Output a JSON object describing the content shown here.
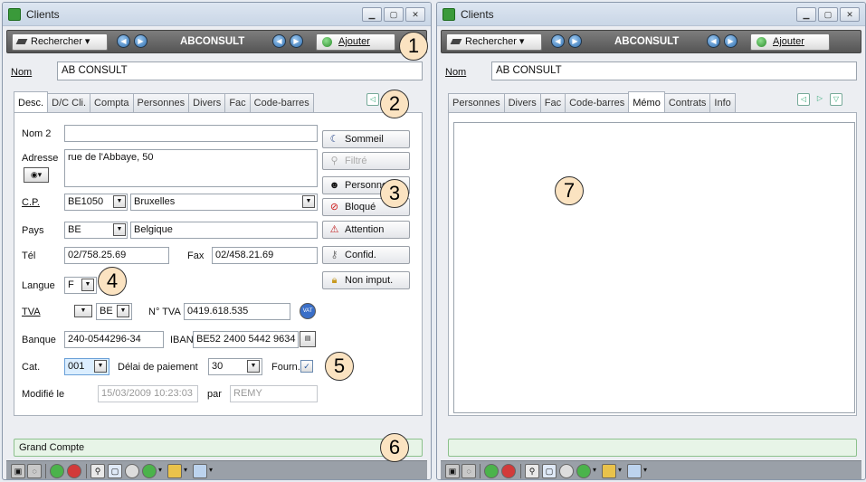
{
  "left": {
    "title": "Clients",
    "toolbar": {
      "search": "Rechercher",
      "company": "ABCONSULT",
      "add": "Ajouter"
    },
    "nom_label": "Nom",
    "nom_value": "AB CONSULT",
    "tabs": [
      "Desc.",
      "D/C Cli.",
      "Compta",
      "Personnes",
      "Divers",
      "Fac",
      "Code-barres"
    ],
    "form": {
      "nom2_label": "Nom 2",
      "nom2_value": "",
      "adresse_label": "Adresse",
      "adresse_value": "rue de l'Abbaye, 50",
      "cp_label": "C.P.",
      "cp_value": "BE1050",
      "city_value": "Bruxelles",
      "pays_label": "Pays",
      "pays_code": "BE",
      "pays_name": "Belgique",
      "tel_label": "Tél",
      "tel_value": "02/758.25.69",
      "fax_label": "Fax",
      "fax_value": "02/458.21.69",
      "langue_label": "Langue",
      "langue_value": "F",
      "tva_label": "TVA",
      "tva_country": "BE",
      "ntva_label": "N° TVA",
      "ntva_value": "0419.618.535",
      "banque_label": "Banque",
      "banque_value": "240-0544296-34",
      "iban_label": "IBAN",
      "iban_value": "BE52 2400 5442 9634",
      "cat_label": "Cat.",
      "cat_value": "001",
      "delai_label": "Délai de paiement",
      "delai_value": "30",
      "fourn_label": "Fourn.",
      "modifie_label": "Modifié le",
      "modifie_value": "15/03/2009 10:23:03",
      "par_label": "par",
      "par_value": "REMY"
    },
    "right_buttons": [
      "Sommeil",
      "Filtré",
      "Personne",
      "Bloqué",
      "Attention",
      "Confid.",
      "Non imput."
    ],
    "status": "Grand Compte"
  },
  "right": {
    "title": "Clients",
    "toolbar": {
      "search": "Rechercher",
      "company": "ABCONSULT",
      "add": "Ajouter"
    },
    "nom_label": "Nom",
    "nom_value": "AB CONSULT",
    "tabs": [
      "Personnes",
      "Divers",
      "Fac",
      "Code-barres",
      "Mémo",
      "Contrats",
      "Info"
    ],
    "status": ""
  },
  "callouts": [
    "1",
    "2",
    "3",
    "4",
    "5",
    "6",
    "7"
  ],
  "icons": {
    "search": "binoculars-icon",
    "add": "green-plus-icon",
    "nav": "blue-arrow-icon"
  }
}
